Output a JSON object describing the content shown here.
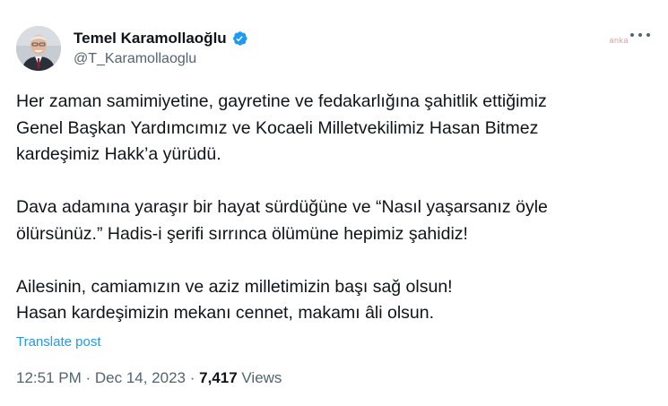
{
  "user": {
    "display_name": "Temel Karamollaoğlu",
    "handle": "@T_Karamollaoglu"
  },
  "watermark": "anka",
  "icons": {
    "verified": "verified-badge-icon",
    "more": "more-options-icon"
  },
  "colors": {
    "verified": "#1d9bf0",
    "link": "#1d9bf0",
    "secondary_text": "#536471",
    "primary_text": "#0f1419"
  },
  "tweet": {
    "paragraphs": [
      {
        "lines": [
          "Her zaman samimiyetine, gayretine ve fedakarlığına şahitlik ettiğimiz",
          "Genel Başkan Yardımcımız ve Kocaeli Milletvekilimiz Hasan Bitmez",
          "kardeşimiz Hakk’a yürüdü."
        ]
      },
      {
        "lines": [
          "Dava adamına yaraşır bir hayat sürdüğüne ve “Nasıl yaşarsanız öyle",
          "ölürsünüz.” Hadis-i şerifi sırrınca ölümüne hepimiz şahidiz!"
        ]
      },
      {
        "lines": [
          "Ailesinin, camiamızın ve aziz milletimizin başı sağ olsun!",
          "Hasan kardeşimizin mekanı cennet, makamı âli olsun."
        ]
      }
    ],
    "translate_label": "Translate post"
  },
  "meta": {
    "time": "12:51 PM",
    "separator": " · ",
    "date": "Dec 14, 2023",
    "separator2": " · ",
    "views_count": "7,417",
    "views_label": " Views"
  }
}
